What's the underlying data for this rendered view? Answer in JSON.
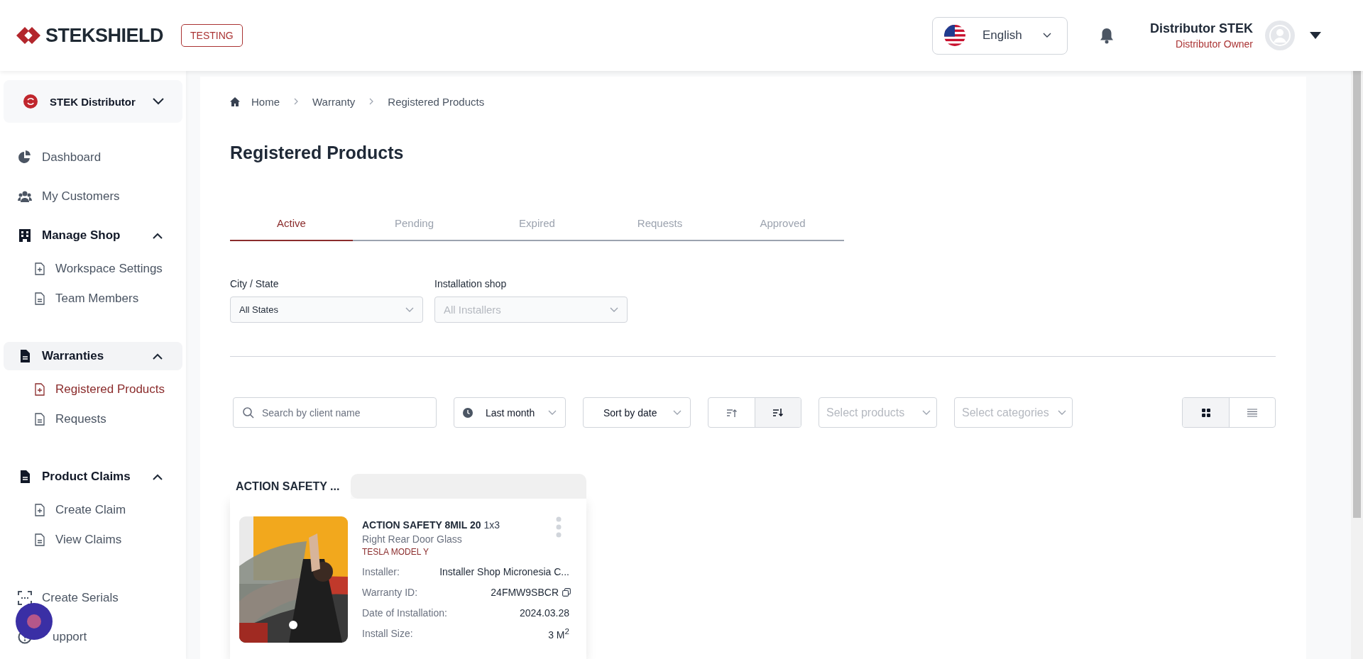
{
  "header": {
    "logo": "STEKSHIELD",
    "env_badge": "TESTING",
    "language": "English",
    "user": {
      "name": "Distributor STEK",
      "role": "Distributor Owner"
    }
  },
  "sidebar": {
    "org": "STEK Distributor",
    "items": [
      {
        "kind": "link",
        "label": "Dashboard",
        "selected": false
      },
      {
        "kind": "link",
        "label": "My Customers",
        "selected": false
      },
      {
        "kind": "group",
        "label": "Manage Shop",
        "expanded": true,
        "active": false,
        "children": [
          {
            "label": "Workspace Settings",
            "selected": false
          },
          {
            "label": "Team Members",
            "selected": false
          }
        ]
      },
      {
        "kind": "group",
        "label": "Warranties",
        "expanded": true,
        "active": true,
        "children": [
          {
            "label": "Registered Products",
            "selected": true
          },
          {
            "label": "Requests",
            "selected": false
          }
        ]
      },
      {
        "kind": "group",
        "label": "Product Claims",
        "expanded": true,
        "active": false,
        "children": [
          {
            "label": "Create Claim",
            "selected": false
          },
          {
            "label": "View Claims",
            "selected": false
          }
        ]
      },
      {
        "kind": "link",
        "label": "Create Serials",
        "selected": false
      },
      {
        "kind": "link",
        "label": "upport",
        "selected": false
      }
    ]
  },
  "breadcrumb": [
    "Home",
    "Warranty",
    "Registered Products"
  ],
  "title": "Registered Products",
  "tabs": [
    {
      "label": "Active",
      "selected": true
    },
    {
      "label": "Pending",
      "selected": false
    },
    {
      "label": "Expired",
      "selected": false
    },
    {
      "label": "Requests",
      "selected": false
    },
    {
      "label": "Approved",
      "selected": false
    }
  ],
  "filters": [
    {
      "label": "City / State",
      "value": "All States"
    },
    {
      "label": "Installation shop",
      "placeholder": "All Installers"
    }
  ],
  "toolbar": {
    "search": {
      "placeholder": "Search by client name"
    },
    "period": "Last month",
    "sort": "Sort by date",
    "sort_order": [
      {
        "kind": "asc",
        "selected": false
      },
      {
        "kind": "desc",
        "selected": true
      }
    ],
    "products": {
      "placeholder": "Select products"
    },
    "categories": {
      "placeholder": "Select categories"
    },
    "view": [
      {
        "kind": "grid",
        "selected": true
      },
      {
        "kind": "list",
        "selected": false
      }
    ]
  },
  "groups": [
    {
      "title": "ACTION SAFETY ...",
      "cards": [
        {
          "product": "ACTION SAFETY 8MIL 20",
          "size_code": "1x3",
          "position": "Right Rear Door Glass",
          "vehicle": "TESLA MODEL Y",
          "fields": [
            {
              "kind": "text",
              "label": "Installer:",
              "value": "Installer Shop Micronesia C..."
            },
            {
              "kind": "copy",
              "label": "Warranty ID:",
              "value": "24FMW9SBCR"
            },
            {
              "kind": "text",
              "label": "Date of Installation:",
              "value": "2024.03.28"
            },
            {
              "kind": "text",
              "label": "Install Size:",
              "value": "3 M$^{2}$"
            }
          ]
        }
      ]
    }
  ]
}
